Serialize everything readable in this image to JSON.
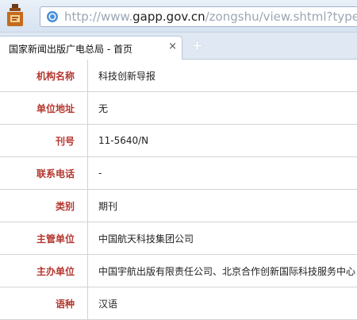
{
  "browser": {
    "url_prefix": "http://www.",
    "url_host": "gapp.gov.cn",
    "url_path": "/zongshu/view.shtml?type=期刊",
    "tab_title": "国家新闻出版广电总局 - 首页",
    "tab_close": "×",
    "new_tab": "+",
    "logo_icon": "browser-logo-icon",
    "secure_icon": "page-icon"
  },
  "rows": [
    {
      "label": "机构名称",
      "value": "科技创新导报"
    },
    {
      "label": "单位地址",
      "value": "无"
    },
    {
      "label": "刊号",
      "value": "11-5640/N"
    },
    {
      "label": "联系电话",
      "value": "-"
    },
    {
      "label": "类别",
      "value": "期刊"
    },
    {
      "label": "主管单位",
      "value": "中国航天科技集团公司"
    },
    {
      "label": "主办单位",
      "value": "中国宇航出版有限责任公司、北京合作创新国际科技服务中心"
    },
    {
      "label": "语种",
      "value": "汉语"
    }
  ],
  "colors": {
    "label": "#b5372f",
    "border": "#d3d3d3"
  }
}
